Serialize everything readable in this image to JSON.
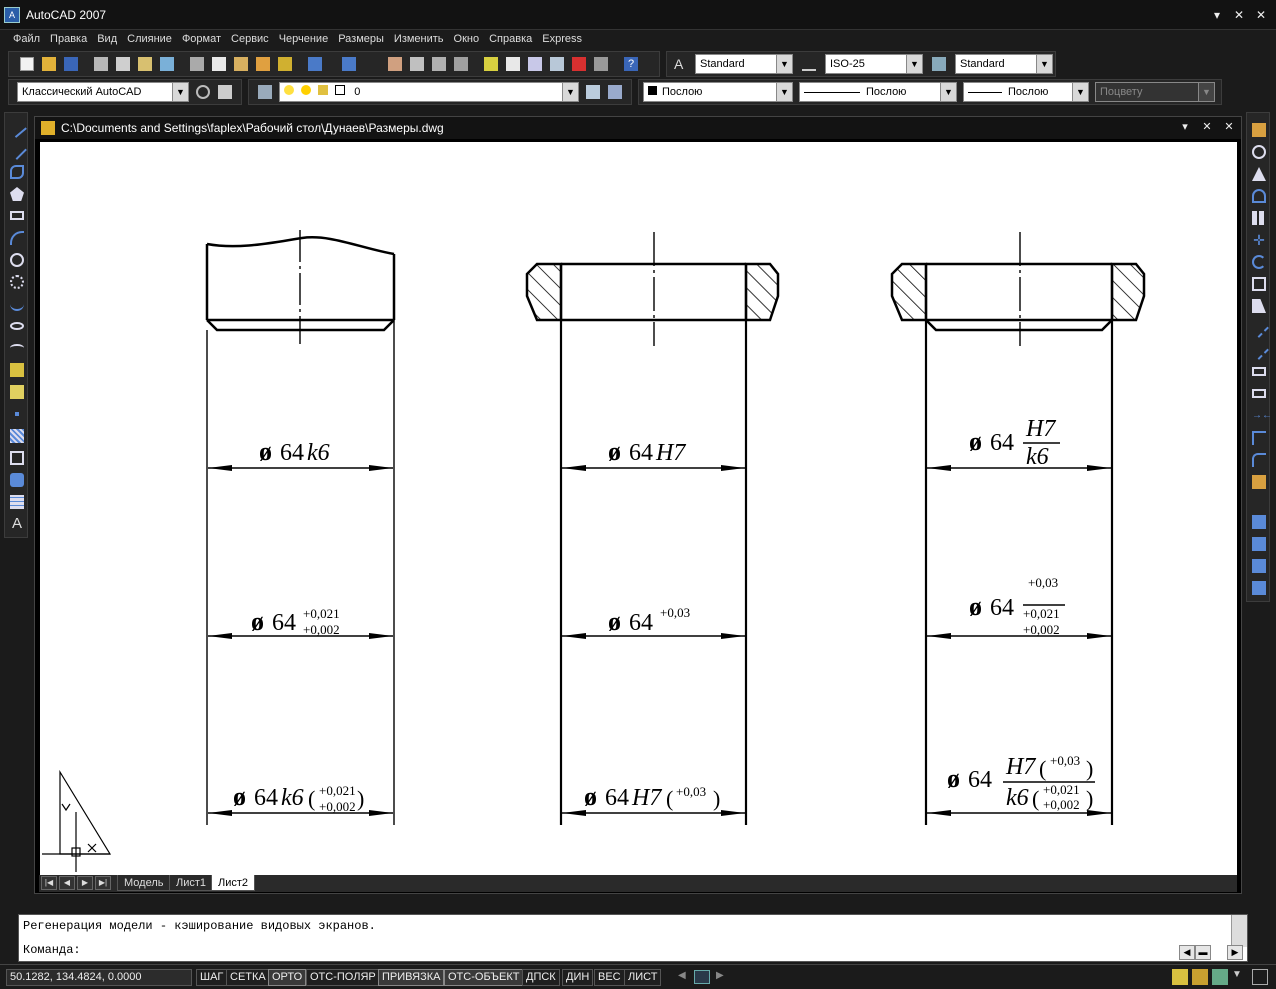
{
  "app": {
    "title": "AutoCAD 2007"
  },
  "menu": [
    "Файл",
    "Правка",
    "Вид",
    "Слияние",
    "Формат",
    "Сервис",
    "Черчение",
    "Размеры",
    "Изменить",
    "Окно",
    "Справка",
    "Express"
  ],
  "toolbar_styles": {
    "text_style": "Standard",
    "dim_style": "ISO-25",
    "table_style": "Standard"
  },
  "toolbar_layers": {
    "workspace": "Классический AutoCAD",
    "layer": "0",
    "color": "Послою",
    "linetype": "Послою",
    "lineweight": "Послою",
    "plotstyle": "Поцвету"
  },
  "document": {
    "title": "C:\\Documents and Settings\\faplex\\Рабочий стол\\Дунаев\\Размеры.dwg",
    "tabs": [
      "Модель",
      "Лист1",
      "Лист2"
    ],
    "active_tab": "Лист2"
  },
  "drawing": {
    "col1": {
      "d1": "64",
      "d1_fit": "k6",
      "d2": "64",
      "d2_up": "+0,021",
      "d2_lo": "+0,002",
      "d3": "64",
      "d3_fit": "k6",
      "d3_up": "+0,021",
      "d3_lo": "+0,002"
    },
    "col2": {
      "d1": "64",
      "d1_fit": "H7",
      "d2": "64",
      "d2_up": "+0,03",
      "d3": "64",
      "d3_fit": "H7",
      "d3_up": "+0,03"
    },
    "col3": {
      "d1": "64",
      "d1_num": "H7",
      "d1_den": "k6",
      "d2": "64",
      "d2_num": "+0,03",
      "d2_den_up": "+0,021",
      "d2_den_lo": "+0,002",
      "d3": "64",
      "d3_num": "H7",
      "d3_num_up": "+0,03",
      "d3_den": "k6",
      "d3_den_up": "+0,021",
      "d3_den_lo": "+0,002"
    },
    "diameter_symbol": "ø"
  },
  "command": {
    "history": "Регенерация модели - кэширование видовых экранов.",
    "prompt": "Команда:"
  },
  "status": {
    "coords": "50.1282, 134.4824, 0.0000",
    "buttons": [
      "ШАГ",
      "СЕТКА",
      "ОРТО",
      "ОТС-ПОЛЯР",
      "ПРИВЯЗКА",
      "ОТС-ОБЪЕКТ",
      "ДПСК",
      "ДИН",
      "ВЕС",
      "ЛИСТ"
    ]
  }
}
